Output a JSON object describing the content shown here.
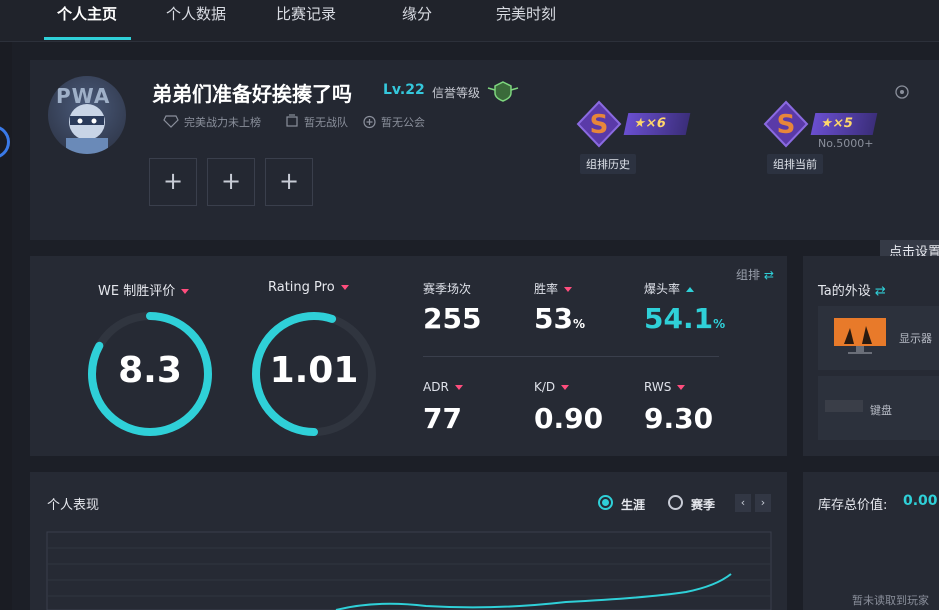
{
  "tabs": [
    "个人主页",
    "个人数据",
    "比赛记录",
    "缘分",
    "完美时刻"
  ],
  "profile": {
    "avatar_text": "PWA",
    "username": "弟弟们准备好挨揍了吗",
    "level": "Lv.22",
    "credit_label": "信誉等级",
    "meta": [
      "完美战力未上榜",
      "暂无战队",
      "暂无公会"
    ],
    "add_slot_glyph": "+"
  },
  "ranks": [
    {
      "letter": "S",
      "stars": "★×6",
      "label": "组排历史",
      "no": ""
    },
    {
      "letter": "S",
      "stars": "★×5",
      "label": "组排当前",
      "no": "No.5000+"
    }
  ],
  "tooltip": "点击设置",
  "stats": {
    "team_toggle": "组排",
    "gauges": [
      {
        "label": "WE 制胜评价",
        "value": "8.3",
        "fill": 0.83
      },
      {
        "label": "Rating Pro",
        "value": "1.01",
        "fill": 0.55
      }
    ],
    "items": [
      {
        "label": "赛季场次",
        "value": "255",
        "unit": ""
      },
      {
        "label": "胜率",
        "value": "53",
        "unit": "%"
      },
      {
        "label": "爆头率",
        "value": "54.1",
        "unit": "%"
      },
      {
        "label": "ADR",
        "value": "77",
        "unit": ""
      },
      {
        "label": "K/D",
        "value": "0.90",
        "unit": ""
      },
      {
        "label": "RWS",
        "value": "9.30",
        "unit": ""
      }
    ]
  },
  "gear": {
    "title": "Ta的外设",
    "items": [
      "显示器",
      "键盘"
    ]
  },
  "perf": {
    "title": "个人表现",
    "options": [
      "生涯",
      "赛季"
    ],
    "prev": "‹",
    "next": "›"
  },
  "inventory": {
    "title": "库存总价值:",
    "value": "0.00",
    "note": "暂未读取到玩家"
  },
  "colors": {
    "accent": "#2fd0d8",
    "pink": "#ff4d7d",
    "bg": "#1c1f27",
    "panel": "#262a34"
  }
}
